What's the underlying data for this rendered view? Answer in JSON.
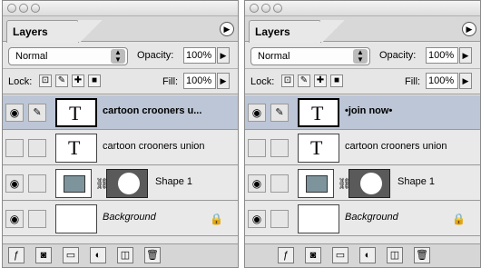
{
  "left_panel": {
    "tab_label": "Layers",
    "blend_mode": "Normal",
    "opacity_label": "Opacity:",
    "opacity_value": "100%",
    "lock_label": "Lock:",
    "fill_label": "Fill:",
    "fill_value": "100%",
    "layers": [
      {
        "name": "cartoon crooners u...",
        "type": "text",
        "selected": true,
        "visible": true
      },
      {
        "name": "cartoon crooners union",
        "type": "text",
        "selected": false,
        "visible": false
      },
      {
        "name": "Shape 1",
        "type": "shape",
        "selected": false,
        "visible": true
      },
      {
        "name": "Background",
        "type": "background",
        "selected": false,
        "visible": true
      }
    ]
  },
  "right_panel": {
    "tab_label": "Layers",
    "blend_mode": "Normal",
    "opacity_label": "Opacity:",
    "opacity_value": "100%",
    "lock_label": "Lock:",
    "fill_label": "Fill:",
    "fill_value": "100%",
    "layers": [
      {
        "name": "•join now•",
        "type": "text",
        "selected": true,
        "visible": true
      },
      {
        "name": "cartoon crooners union",
        "type": "text",
        "selected": false,
        "visible": false
      },
      {
        "name": "Shape 1",
        "type": "shape",
        "selected": false,
        "visible": true
      },
      {
        "name": "Background",
        "type": "background",
        "selected": false,
        "visible": true
      }
    ]
  },
  "icons": {
    "thumb_text_glyph": "T",
    "eye": "eye-icon",
    "brush": "brush-icon",
    "link": "link-icon",
    "lock": "lock-icon"
  },
  "colors": {
    "selected_row": "#bcc6d6",
    "shape_fill": "#7e949d",
    "panel_bg": "#e6e6e6"
  }
}
